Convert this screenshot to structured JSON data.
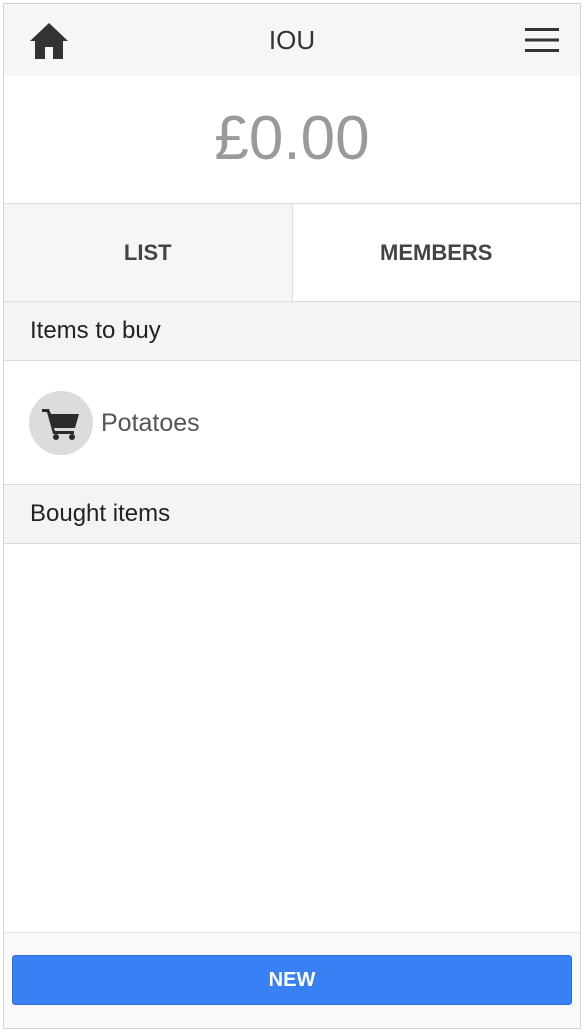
{
  "header": {
    "title": "IOU",
    "home_icon": "home-icon",
    "menu_icon": "hamburger-menu-icon"
  },
  "balance": "£0.00",
  "tabs": [
    {
      "label": "LIST",
      "active": true
    },
    {
      "label": "MEMBERS",
      "active": false
    }
  ],
  "sections": {
    "to_buy": {
      "title": "Items to buy",
      "items": [
        {
          "label": "Potatoes",
          "icon": "cart-icon"
        }
      ]
    },
    "bought": {
      "title": "Bought items",
      "items": []
    }
  },
  "footer": {
    "new_label": "NEW"
  },
  "colors": {
    "primary_button": "#3880f4",
    "balance_text": "#9a9a9a",
    "header_bg": "#f6f6f6"
  }
}
